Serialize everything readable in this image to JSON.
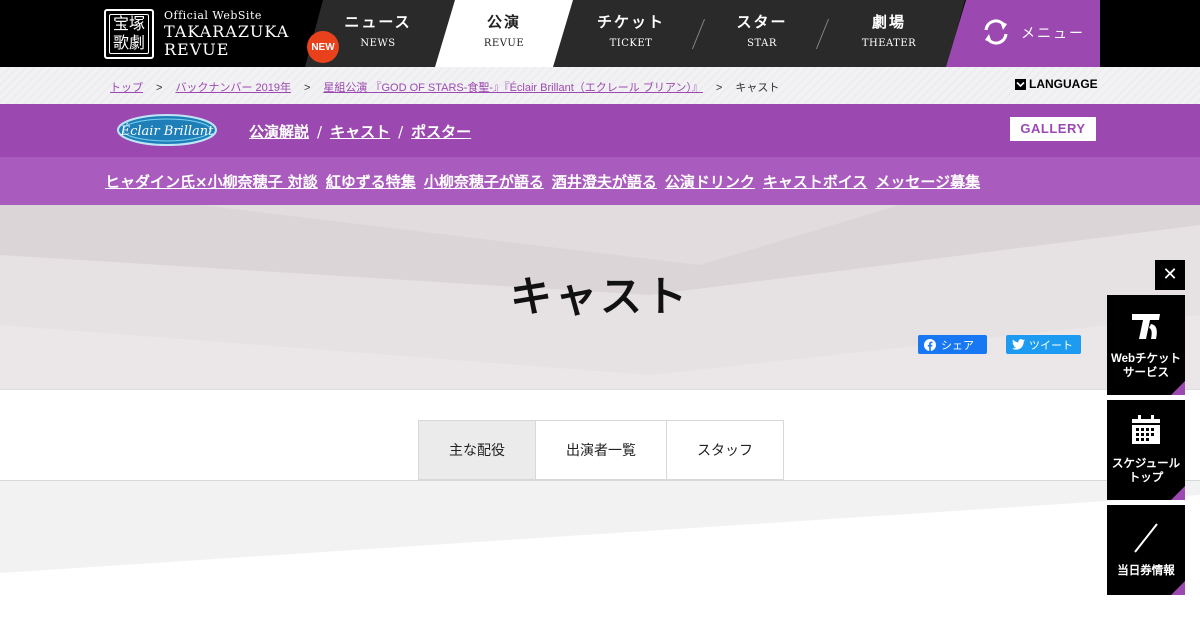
{
  "header": {
    "logo": {
      "kanji_top": "宝塚",
      "kanji_bottom": "歌劇",
      "official": "Official WebSite",
      "name_line1": "TAKARAZUKA",
      "name_line2": "REVUE"
    },
    "nav": [
      {
        "ja": "ニュース",
        "en": "NEWS",
        "badge": "NEW"
      },
      {
        "ja": "公演",
        "en": "REVUE",
        "active": true
      },
      {
        "ja": "チケット",
        "en": "TICKET"
      },
      {
        "ja": "スター",
        "en": "STAR"
      },
      {
        "ja": "劇場",
        "en": "THEATER"
      }
    ],
    "menu_label": "メニュー"
  },
  "breadcrumb": {
    "items": [
      "トップ",
      "バックナンバー 2019年",
      "星組公演 『GOD OF STARS-食聖-』『Éclair Brillant（エクレール ブリアン）』"
    ],
    "current": "キャスト",
    "separator": ">"
  },
  "language_label": "LANGUAGE",
  "show_nav": {
    "logo_text": "Éclair Brillant",
    "links": [
      "公演解説",
      "キャスト",
      "ポスター"
    ],
    "separator": "/",
    "gallery": "GALLERY"
  },
  "features": [
    "ヒャダイン氏×小柳奈穂子 対談",
    "紅ゆずる特集",
    "小柳奈穂子が語る",
    "酒井澄夫が語る",
    "公演ドリンク",
    "キャストボイス",
    "メッセージ募集"
  ],
  "page_title": "キャスト",
  "share": {
    "facebook": "シェア",
    "twitter": "ツイート"
  },
  "tabs": [
    {
      "label": "主な配役",
      "active": true
    },
    {
      "label": "出演者一覧"
    },
    {
      "label": "スタッフ"
    }
  ],
  "side_widget": {
    "close": "✕",
    "web_ticket": [
      "Webチケット",
      "サービス"
    ],
    "schedule": [
      "スケジュール",
      "トップ"
    ],
    "same_day": "当日券情報"
  },
  "colors": {
    "purple": "#9b49b0",
    "purple_light": "#aa5bbe",
    "black": "#000000",
    "new_badge": "#e8411c"
  }
}
